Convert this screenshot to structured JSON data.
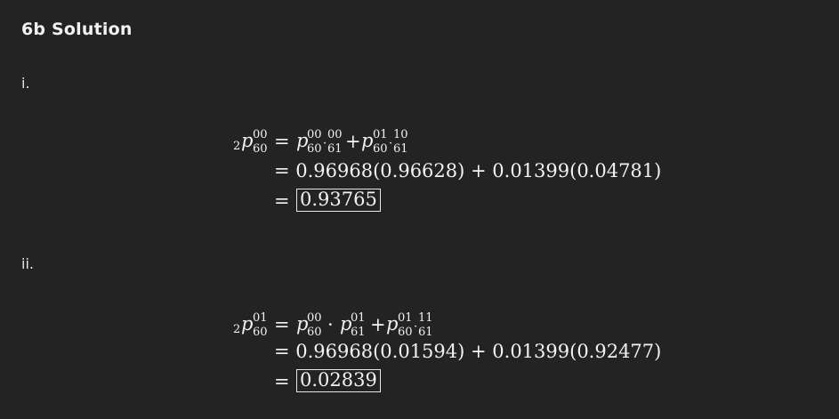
{
  "heading": "6b Solution",
  "parts": [
    {
      "label": "i.",
      "lhs": {
        "pre_sub": "2",
        "base": "p",
        "sup": "00",
        "sub": "60"
      },
      "rhs_line1": {
        "t1": {
          "base": "p",
          "sup": "00",
          "sub": "60"
        },
        "t2": {
          "sup": "00",
          "sub": "61"
        },
        "plus": "+",
        "t3": {
          "base": "p",
          "sup": "01",
          "sub": "60"
        },
        "t4": {
          "sup": "10",
          "sub": "61"
        }
      },
      "line2": "= 0.96968(0.96628) + 0.01399(0.04781)",
      "eq_sign": "=",
      "result": "0.93765"
    },
    {
      "label": "ii.",
      "lhs": {
        "pre_sub": "2",
        "base": "p",
        "sup": "01",
        "sub": "60"
      },
      "rhs_line1": {
        "t1": {
          "base": "p",
          "sup": "00",
          "sub": "60"
        },
        "dot": "·",
        "t2": {
          "base": "p",
          "sup": "01",
          "sub": "61"
        },
        "plus": "+",
        "t3": {
          "base": "p",
          "sup": "01",
          "sub": "60"
        },
        "t4": {
          "sup": "11",
          "sub": "61"
        }
      },
      "line2": "= 0.96968(0.01594) + 0.01399(0.92477)",
      "eq_sign": "=",
      "result": "0.02839"
    }
  ]
}
